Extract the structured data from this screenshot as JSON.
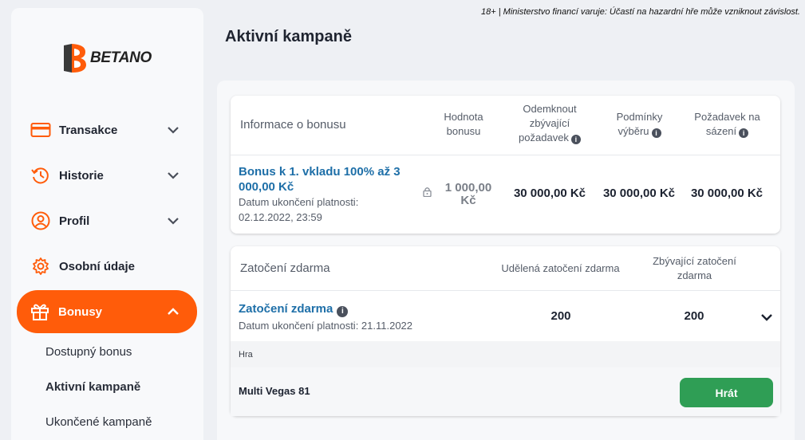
{
  "disclaimer": "18+ | Ministerstvo financí varuje: Účastí na hazardní hře může vzniknout závislost.",
  "brand": {
    "name": "BETANO",
    "accent": "#ff5c0a"
  },
  "nav": {
    "items": [
      {
        "label": "Transakce",
        "icon": "card-icon"
      },
      {
        "label": "Historie",
        "icon": "history-icon"
      },
      {
        "label": "Profil",
        "icon": "user-icon"
      },
      {
        "label": "Osobní údaje",
        "icon": "gear-icon"
      },
      {
        "label": "Bonusy",
        "icon": "gift-icon",
        "active": true
      }
    ],
    "sub_items": [
      "Dostupný bonus",
      "Aktivní kampaně",
      "Ukončené kampaně"
    ]
  },
  "page": {
    "title": "Aktivní kampaně"
  },
  "bonus_table": {
    "headers": {
      "info": "Informace o bonusu",
      "value_l1": "Hodnota",
      "value_l2": "bonusu",
      "unlock_l1": "Odemknout",
      "unlock_l2": "zbývající",
      "unlock_l3": "požadavek",
      "withdraw_l1": "Podmínky",
      "withdraw_l2": "výběru",
      "wager_l1": "Požadavek na",
      "wager_l2": "sázení"
    },
    "row": {
      "name_l1": "Bonus k 1. vkladu 100% až 3",
      "name_l2": "000,00 Kč",
      "expiry_l1": "Datum ukončení platnosti:",
      "expiry_l2": "02.12.2022, 23:59",
      "value_l1": "1 000,00",
      "value_l2": "Kč",
      "unlock": "30 000,00 Kč",
      "withdraw": "30 000,00 Kč",
      "wager": "30 000,00 Kč"
    }
  },
  "spins_table": {
    "headers": {
      "title": "Zatočení zdarma",
      "granted": "Udělená zatočení zdarma",
      "remaining_l1": "Zbývající zatočení",
      "remaining_l2": "zdarma"
    },
    "row": {
      "name": "Zatočení zdarma",
      "expiry": "Datum ukončení platnosti: 21.11.2022",
      "granted": "200",
      "remaining": "200"
    },
    "game_label": "Hra",
    "game_name": "Multi Vegas 81",
    "play_label": "Hrát"
  }
}
